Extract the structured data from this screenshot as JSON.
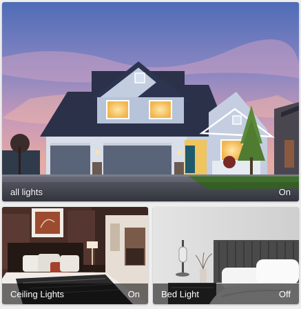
{
  "tiles": [
    {
      "label": "all lights",
      "state": "On"
    },
    {
      "label": "Ceiling Lights",
      "state": "On"
    },
    {
      "label": "Bed Light",
      "state": "Off"
    }
  ],
  "colors": {
    "sky_top": "#5a72b8",
    "sky_mid": "#b78ab8",
    "sky_low": "#e9a6a0",
    "roof": "#2a3148",
    "siding": "#c5cfe0",
    "window_glow": "#f4c060",
    "lawn": "#3c6a2a",
    "bar_bg": "#000000",
    "text": "#ffffff"
  }
}
